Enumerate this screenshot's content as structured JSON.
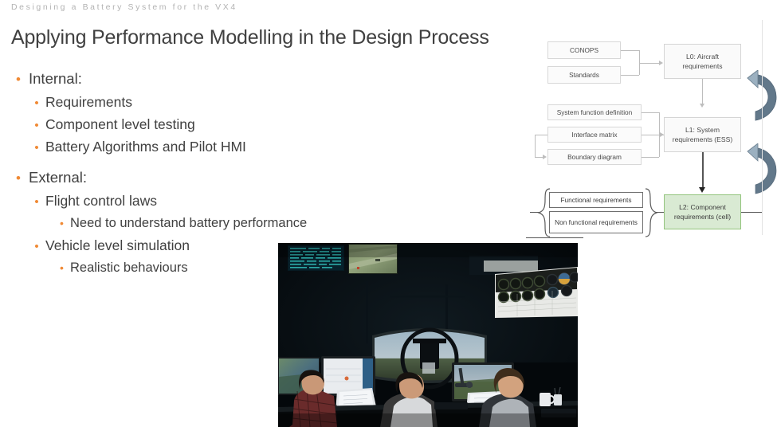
{
  "header": {
    "kicker": "Designing a Battery System for the VX4",
    "title": "Applying Performance Modelling in the Design Process"
  },
  "bullets": [
    {
      "level": 1,
      "text": "Internal:"
    },
    {
      "level": 2,
      "text": "Requirements"
    },
    {
      "level": 2,
      "text": "Component level testing"
    },
    {
      "level": 2,
      "text": "Battery Algorithms and Pilot HMI"
    },
    {
      "level": 1,
      "text": "External:"
    },
    {
      "level": 2,
      "text": "Flight control laws"
    },
    {
      "level": 3,
      "text": "Need to understand battery performance"
    },
    {
      "level": 2,
      "text": "Vehicle level simulation"
    },
    {
      "level": 3,
      "text": "Realistic behaviours"
    }
  ],
  "bullet_marker": "•",
  "diagram": {
    "inputs_top": [
      "CONOPS",
      "Standards"
    ],
    "inputs_mid": [
      "System function definition",
      "Interface matrix",
      "Boundary diagram"
    ],
    "inputs_bottom": [
      "Functional requirements",
      "Non functional requirements"
    ],
    "levels": [
      {
        "id": "L0",
        "text": "L0: Aircraft requirements"
      },
      {
        "id": "L1",
        "text": "L1: System requirements (ESS)"
      },
      {
        "id": "L2",
        "text": "L2: Component requirements (cell)"
      }
    ],
    "colors": {
      "green_fill": "#d9ead3",
      "green_border": "#93c47d",
      "box_border": "#d8d8d8",
      "connector": "#bdbdbd",
      "arrow_fill_light": "#a7b8c4",
      "arrow_fill_dark": "#5f7585"
    },
    "feedback_arrows": 2
  },
  "photo": {
    "caption": "flight-simulator-control-room-photo",
    "description": "Three engineers seated at dark control room workstations facing monitors and a flight simulator screen"
  },
  "theme": {
    "bullet_color": "#f08a35",
    "text_color": "#404040",
    "kicker_color": "#b3b3b3",
    "background": "#ffffff"
  }
}
